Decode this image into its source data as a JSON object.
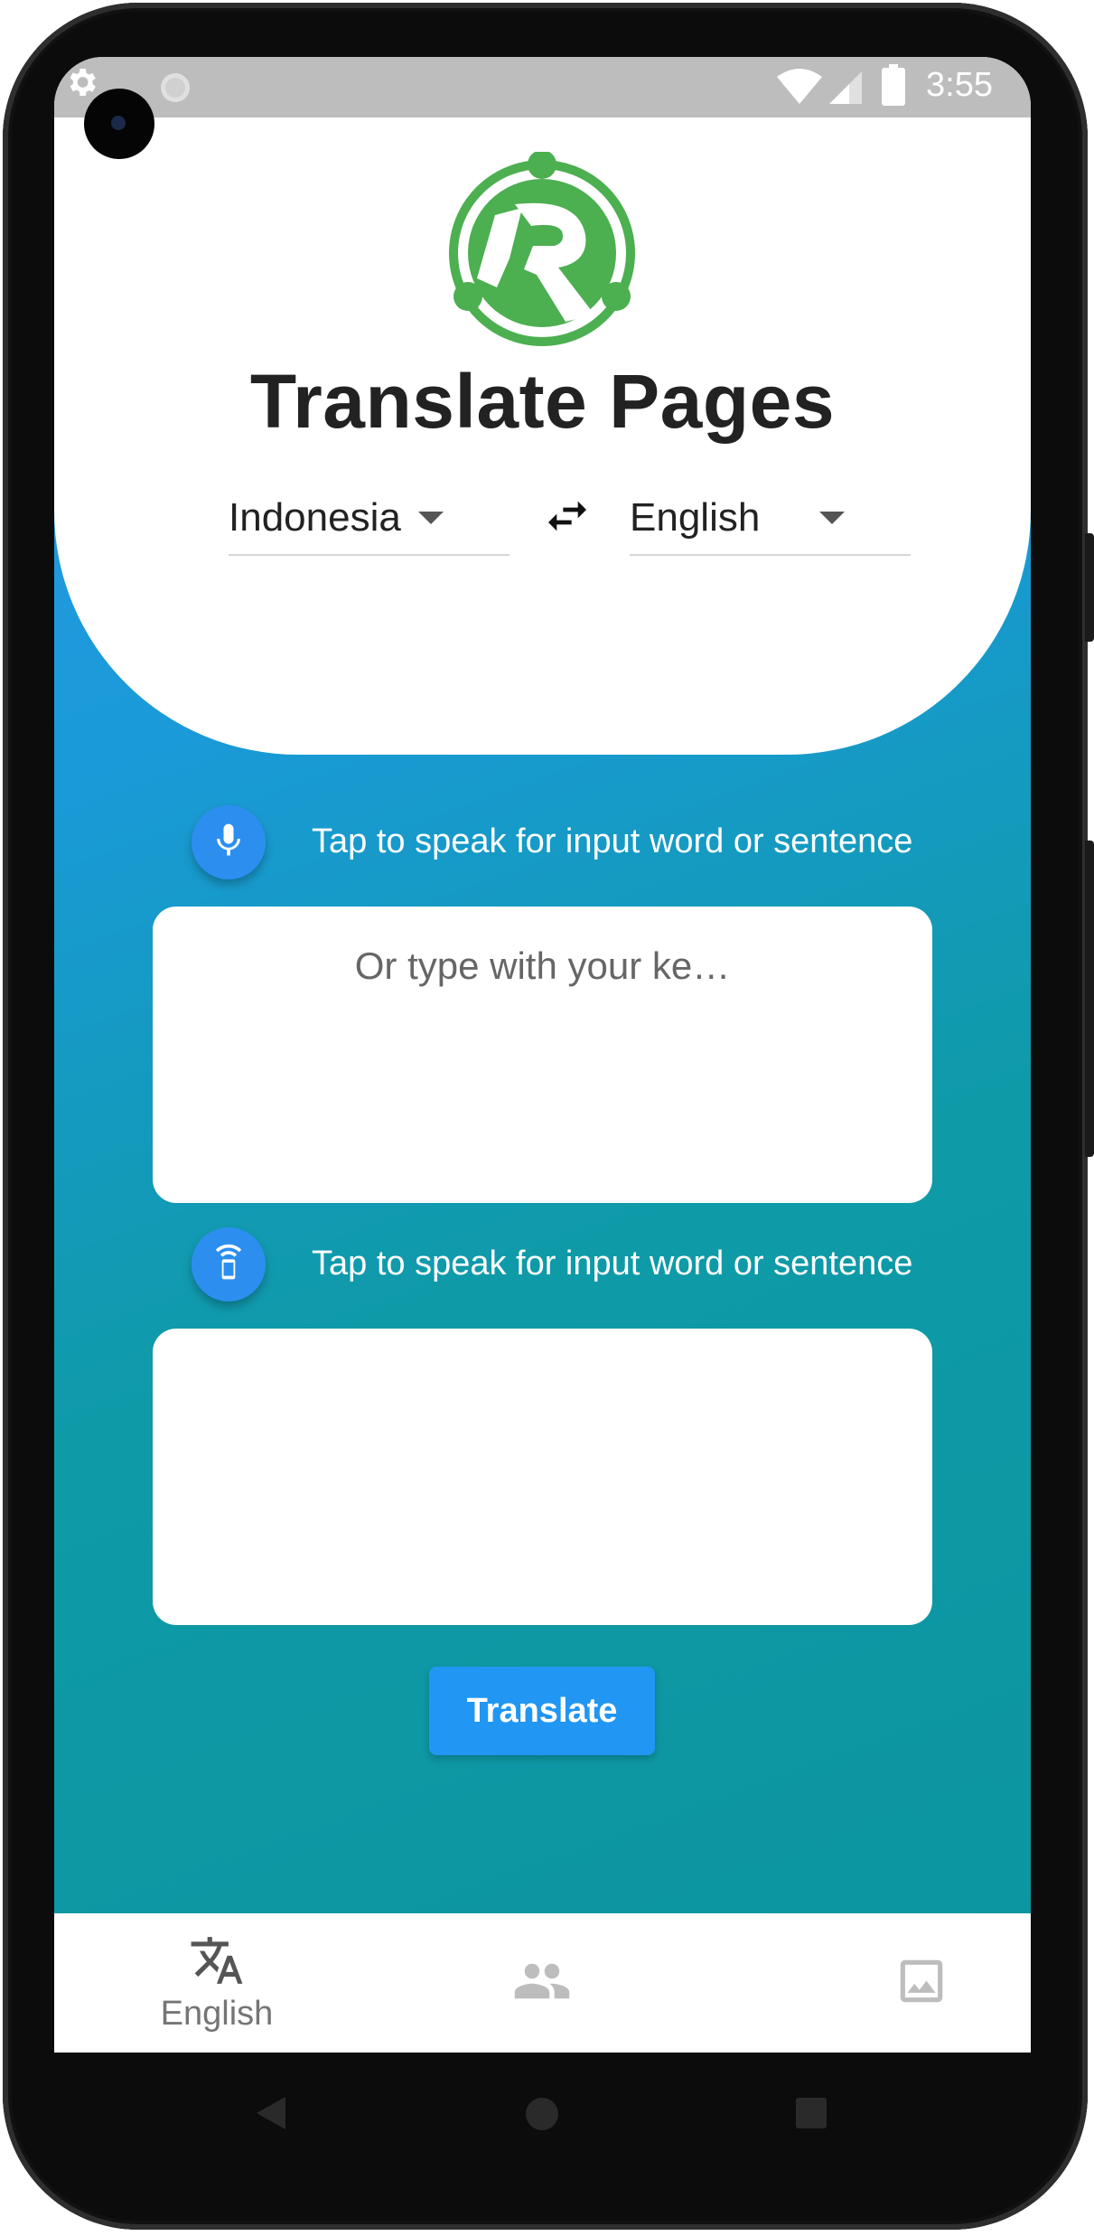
{
  "status_bar": {
    "time": "3:55"
  },
  "header": {
    "title": "Translate Pages",
    "source_language": "Indonesia",
    "target_language": "English"
  },
  "input_section": {
    "speak_hint": "Tap to speak for input word or sentence",
    "placeholder": "Or type with your ke…",
    "value": ""
  },
  "output_section": {
    "speak_hint": "Tap to speak for input word or sentence",
    "value": ""
  },
  "translate_button": {
    "label": "Translate"
  },
  "bottom_nav": {
    "items": [
      {
        "label": "English",
        "icon": "translate-icon",
        "selected": true
      },
      {
        "label": "",
        "icon": "people-icon",
        "selected": false
      },
      {
        "label": "",
        "icon": "image-icon",
        "selected": false
      }
    ]
  },
  "colors": {
    "accent": "#2196f3",
    "logo_green": "#4caf50",
    "gradient_top": "#2a9be7",
    "gradient_bottom": "#0c95a0"
  }
}
